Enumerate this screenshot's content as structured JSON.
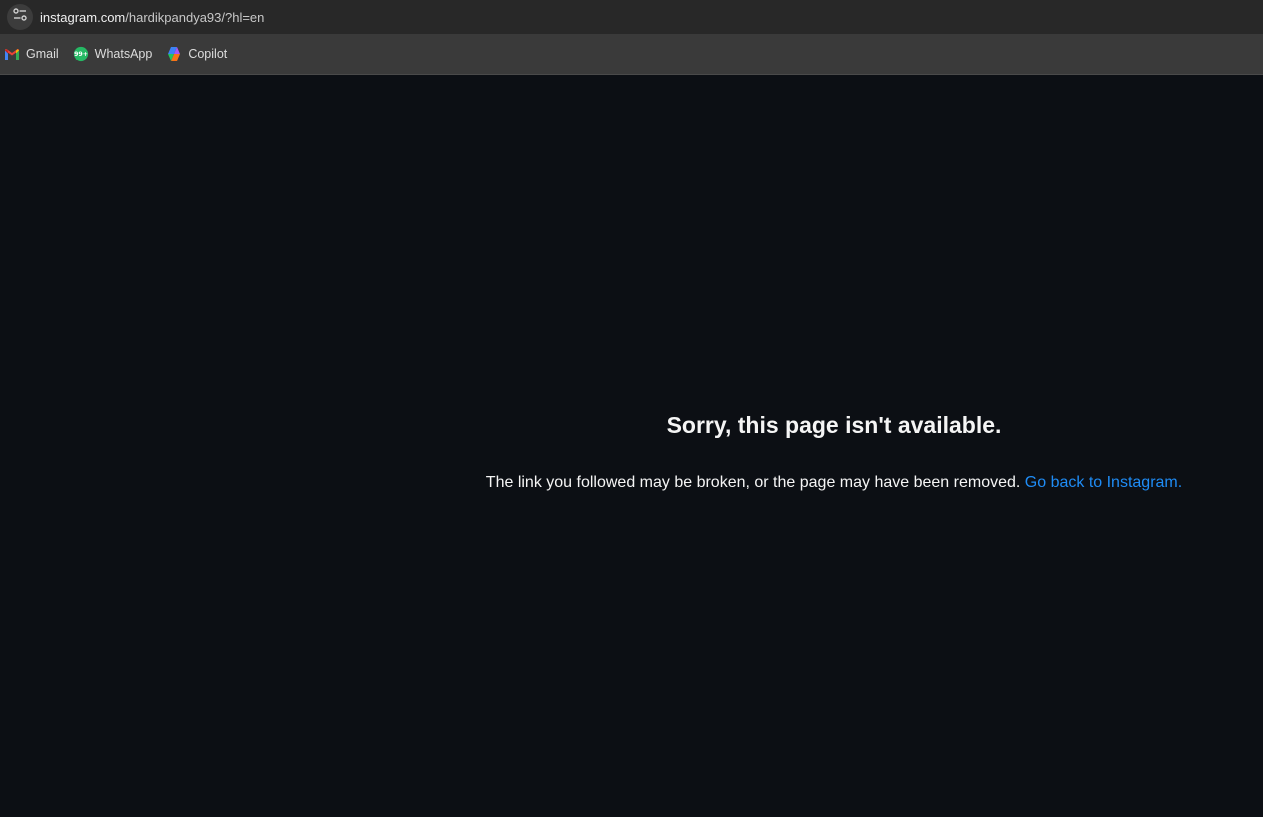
{
  "browser": {
    "url_domain": "instagram.com",
    "url_path": "/hardikpandya93/?hl=en",
    "site_info_icon": "tune-icon",
    "bookmarks": [
      {
        "label": "Gmail",
        "icon": "gmail-icon"
      },
      {
        "label": "WhatsApp",
        "icon": "whatsapp-icon",
        "badge": "99+"
      },
      {
        "label": "Copilot",
        "icon": "copilot-icon"
      }
    ]
  },
  "page": {
    "title": "Sorry, this page isn't available.",
    "message": "The link you followed may be broken, or the page may have been removed.",
    "link_text": "Go back to Instagram."
  },
  "colors": {
    "background": "#0c0f14",
    "link": "#1f8cf5",
    "text": "#f5f5f5"
  }
}
